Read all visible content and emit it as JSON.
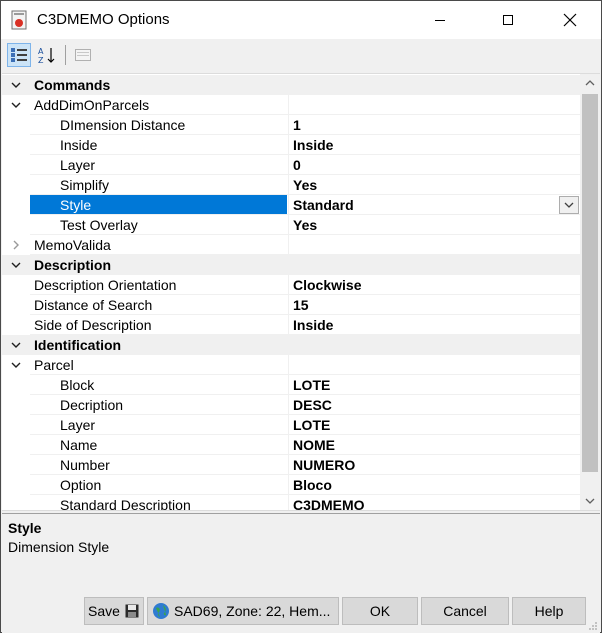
{
  "window": {
    "title": "C3DMEMO Options"
  },
  "toolbar": {
    "categorized_icon": "categorized-view-icon",
    "alphabetical_icon": "alphabetical-sort-icon",
    "property_pages_icon": "property-pages-icon"
  },
  "grid": {
    "rows": [
      {
        "kind": "category",
        "expander": "expanded",
        "name": "Commands",
        "value": ""
      },
      {
        "kind": "group",
        "expander": "expanded",
        "name": "AddDimOnParcels",
        "value": ""
      },
      {
        "kind": "prop",
        "name": "DImension Distance",
        "value": "1"
      },
      {
        "kind": "prop",
        "name": "Inside",
        "value": "Inside"
      },
      {
        "kind": "prop",
        "name": "Layer",
        "value": "0"
      },
      {
        "kind": "prop",
        "name": "Simplify",
        "value": "Yes"
      },
      {
        "kind": "prop",
        "name": "Style",
        "value": "Standard",
        "selected": true
      },
      {
        "kind": "prop",
        "name": "Test Overlay",
        "value": "Yes"
      },
      {
        "kind": "group",
        "expander": "collapsed",
        "name": "MemoValida",
        "value": ""
      },
      {
        "kind": "category",
        "expander": "expanded",
        "name": "Description",
        "value": ""
      },
      {
        "kind": "prop1",
        "name": "Description Orientation",
        "value": "Clockwise"
      },
      {
        "kind": "prop1",
        "name": "Distance of Search",
        "value": "15"
      },
      {
        "kind": "prop1",
        "name": "Side of Description",
        "value": "Inside"
      },
      {
        "kind": "category",
        "expander": "expanded",
        "name": "Identification",
        "value": ""
      },
      {
        "kind": "group",
        "expander": "expanded",
        "name": "Parcel",
        "value": ""
      },
      {
        "kind": "prop",
        "name": "Block",
        "value": "LOTE"
      },
      {
        "kind": "prop",
        "name": "Decription",
        "value": "DESC"
      },
      {
        "kind": "prop",
        "name": "Layer",
        "value": "LOTE"
      },
      {
        "kind": "prop",
        "name": "Name",
        "value": "NOME"
      },
      {
        "kind": "prop",
        "name": "Number",
        "value": "NUMERO"
      },
      {
        "kind": "prop",
        "name": "Option",
        "value": "Bloco"
      },
      {
        "kind": "prop",
        "name": "Standard Description",
        "value": "C3DMEMO"
      }
    ]
  },
  "description": {
    "title": "Style",
    "text": "Dimension Style"
  },
  "buttons": {
    "save": "Save",
    "coordinate_system": "SAD69, Zone: 22, Hem...",
    "ok": "OK",
    "cancel": "Cancel",
    "help": "Help"
  },
  "colors": {
    "selection": "#0078d7",
    "category_background": "#f0f0f0"
  }
}
